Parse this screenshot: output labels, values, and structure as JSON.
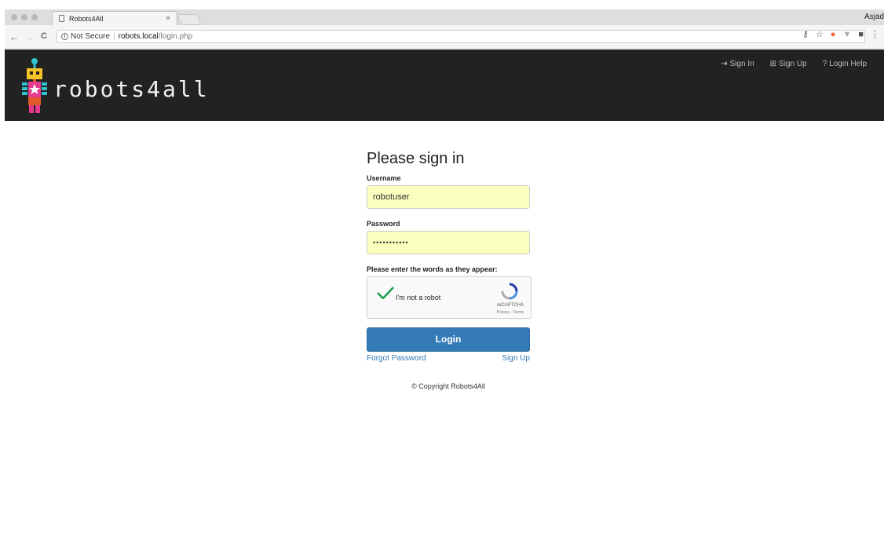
{
  "browser": {
    "tab_title": "Robots4All",
    "tab_close": "×",
    "profile_name": "Asjad",
    "url_security": "Not Secure",
    "url_host": "robots.local",
    "url_path": "/login.php",
    "nav_back": "←",
    "nav_forward": "→",
    "nav_reload": "C"
  },
  "navbar": {
    "brand": "robots4all",
    "links": [
      {
        "label": "Sign In",
        "icon": "sign-in-icon",
        "glyph": "⇥"
      },
      {
        "label": "Sign Up",
        "icon": "plus-square-icon",
        "glyph": "⊞"
      },
      {
        "label": "Login Help",
        "icon": "question-circle-icon",
        "glyph": "?"
      }
    ]
  },
  "form": {
    "heading": "Please sign in",
    "username_label": "Username",
    "username_value": "robotuser",
    "password_label": "Password",
    "password_value": "•••••••••••",
    "captcha_label": "Please enter the words as they appear:",
    "captcha_text": "I'm not a robot",
    "captcha_brand": "reCAPTCHA",
    "captcha_terms": "Privacy - Terms",
    "login_button": "Login",
    "forgot_password": "Forgot Password",
    "sign_up": "Sign Up"
  },
  "footer": {
    "copyright": "© Copyright Robots4All"
  },
  "colors": {
    "navbar_bg": "#222222",
    "primary": "#337ab7",
    "autofill_bg": "#faffbd",
    "check_green": "#1e9e4a"
  }
}
